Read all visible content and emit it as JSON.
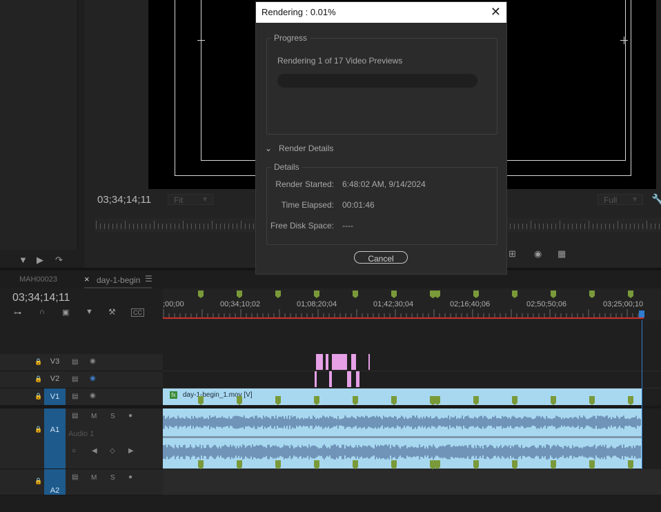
{
  "colors": {
    "accent_blue": "#1e5a8c",
    "clip": "#a8d8f0",
    "marker": "#7a9a3a",
    "pink_clip": "#e6a0e6",
    "playhead": "#2f7dd0"
  },
  "program": {
    "timecode": "03;34;14;11",
    "fit_select": "Fit",
    "quality_select": "Full"
  },
  "dialog": {
    "title": "Rendering : 0.01%",
    "progress_legend": "Progress",
    "progress_text": "Rendering 1 of 17 Video Previews",
    "progress_fraction": 0.0001,
    "details_toggle": "Render Details",
    "details_legend": "Details",
    "render_started_label": "Render Started:",
    "render_started_value": "6:48:02 AM, 9/14/2024",
    "time_elapsed_label": "Time Elapsed:",
    "time_elapsed_value": "00:01:46",
    "free_disk_label": "Free Disk Space:",
    "free_disk_value": "----",
    "cancel_label": "Cancel"
  },
  "timeline": {
    "tab_source": "MAH00023",
    "tab_sequence": "day-1-begin",
    "timecode": "03;34;14;11",
    "ruler_labels": [
      ";00;00",
      "00;34;10;02",
      "01;08;20;04",
      "01;42;30;04",
      "02;16;40;06",
      "02;50;50;06",
      "03;25;00;10"
    ],
    "tracks": {
      "v3": "V3",
      "v2": "V2",
      "v1": "V1",
      "a1": "A1",
      "a1_name": "Audio 1",
      "a2": "A2",
      "mute": "M",
      "solo": "S"
    },
    "clip_name": "day-1-begin_1.mov [V]",
    "clip_fx": "fx"
  }
}
